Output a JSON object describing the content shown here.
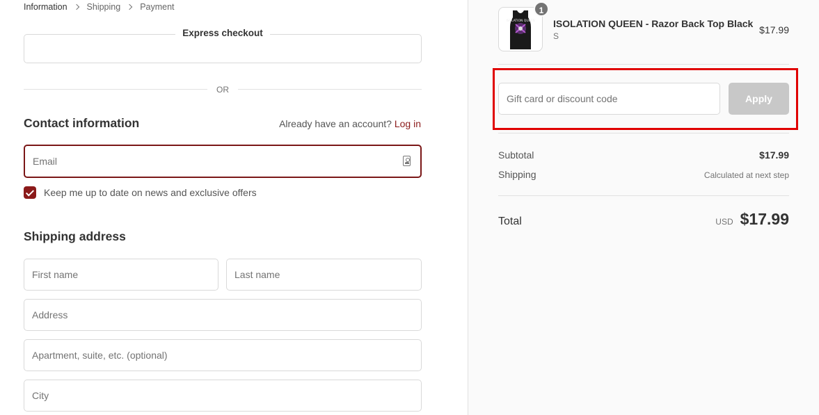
{
  "breadcrumb": {
    "items": [
      "Information",
      "Shipping",
      "Payment"
    ]
  },
  "express": {
    "title": "Express checkout"
  },
  "divider": {
    "or": "OR"
  },
  "contact": {
    "title": "Contact information",
    "account_prompt": "Already have an account?",
    "login_label": "Log in",
    "email_placeholder": "Email",
    "newsletter_label": "Keep me up to date on news and exclusive offers",
    "newsletter_checked": true
  },
  "shipping": {
    "title": "Shipping address",
    "first_name_placeholder": "First name",
    "last_name_placeholder": "Last name",
    "address_placeholder": "Address",
    "apartment_placeholder": "Apartment, suite, etc. (optional)",
    "city_placeholder": "City"
  },
  "order": {
    "product": {
      "name": "ISOLATION QUEEN - Razor Back Top Black",
      "variant": "S",
      "price": "$17.99",
      "quantity": "1",
      "image_text": "ISOLATION QUEEN"
    },
    "discount_placeholder": "Gift card or discount code",
    "apply_label": "Apply",
    "subtotal_label": "Subtotal",
    "subtotal_value": "$17.99",
    "shipping_label": "Shipping",
    "shipping_value": "Calculated at next step",
    "total_label": "Total",
    "currency": "USD",
    "total_value": "$17.99"
  },
  "colors": {
    "accent": "#8b1a1a",
    "highlight": "#e00000"
  }
}
